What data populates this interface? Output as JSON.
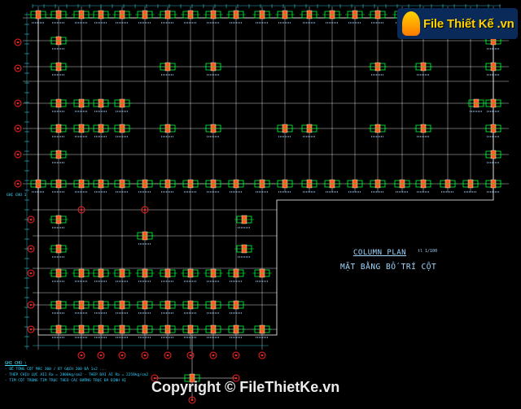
{
  "logo": {
    "text": "File Thiết Kế .vn"
  },
  "plan": {
    "title": "COLUMN PLAN",
    "scale": "tl 1/100",
    "subtitle": "MẶT BẰNG BỐ TRÍ CỘT"
  },
  "notes": {
    "heading": "GHI CHÚ :",
    "lines": [
      "- BÊ TÔNG CỘT MÁC 300 / BT GẠCH 200 ĐÁ 1x2 ...",
      "- THÉP CHỊU LỰC AII Ra = 2800kg/cm2 - THÉP ĐAI AI Ra = 2250kg/cm2",
      "- TIM CỘT TRÙNG TIM TRỤC THEO CÁC ĐƯỜNG TRỤC ĐÃ ĐỊNH VỊ"
    ]
  },
  "left_note": "GHI CHÚ 1",
  "watermark": "Copyright © FileThietKe.vn",
  "colors": {
    "background": "#000000",
    "grid": "#ffffff",
    "column_fill": "#ff5a1f",
    "column_detail": "#00ff3c",
    "axis_marker": "#ff2020",
    "text": "#9fd7ff"
  }
}
